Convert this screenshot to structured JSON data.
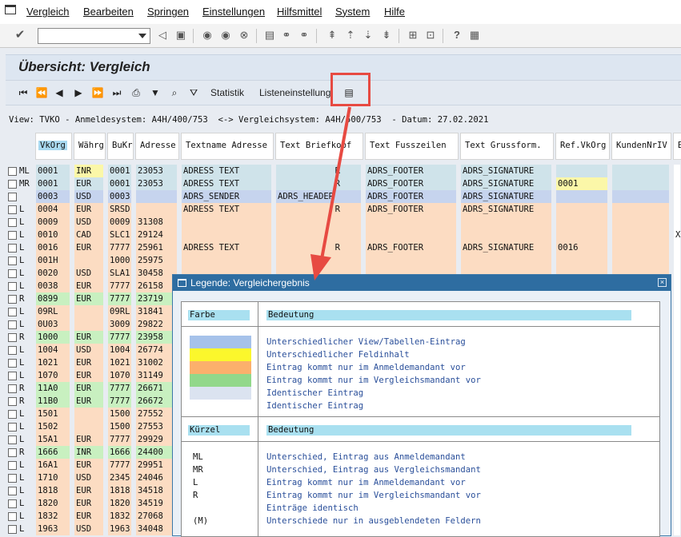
{
  "menu": [
    "Vergleich",
    "Bearbeiten",
    "Springen",
    "Einstellungen",
    "Hilfsmittel",
    "System",
    "Hilfe"
  ],
  "command_field": {
    "value": ""
  },
  "screen": {
    "title": "Übersicht: Vergleich"
  },
  "app_toolbar": {
    "statistik": "Statistik",
    "listeneinstellung": "Listeneinstellung"
  },
  "view_line": "View: TVKO - Anmeldesystem: A4H/400/753  <-> Vergleichsystem: A4H/500/753  - Datum: 27.02.2021",
  "table": {
    "headers": [
      "VkOrg",
      "Währg",
      "BuKr",
      "Adresse",
      "Textname Adresse",
      "Text Briefkopf",
      "Text Fusszeilen",
      "Text Grussform.",
      "Ref.VkOrg",
      "KundenNrIV",
      "B"
    ],
    "rows": [
      {
        "k": "ML",
        "c": [
          "0001",
          "INR",
          "0001",
          "23053",
          "ADRESS TEXT",
          "R",
          "ADRS_FOOTER",
          "ADRS_SIGNATURE",
          "",
          "",
          ""
        ]
      },
      {
        "k": "MR",
        "c": [
          "0001",
          "EUR",
          "0001",
          "23053",
          "ADRESS TEXT",
          "R",
          "ADRS_FOOTER",
          "ADRS_SIGNATURE",
          "0001",
          "",
          ""
        ]
      },
      {
        "k": "",
        "c": [
          "0003",
          "USD",
          "0003",
          "",
          "ADRS_SENDER",
          "ADRS_HEADER",
          "ADRS_FOOTER",
          "ADRS_SIGNATURE",
          "",
          "",
          ""
        ]
      },
      {
        "k": "L",
        "c": [
          "0004",
          "EUR",
          "SRSD",
          "",
          "ADRESS TEXT",
          "R",
          "ADRS_FOOTER",
          "ADRS_SIGNATURE",
          "",
          "",
          ""
        ]
      },
      {
        "k": "L",
        "c": [
          "0009",
          "USD",
          "0009",
          "31308",
          "",
          "",
          "",
          "",
          "",
          "",
          ""
        ]
      },
      {
        "k": "L",
        "c": [
          "0010",
          "CAD",
          "SLC1",
          "29124",
          "",
          "",
          "",
          "",
          "",
          "",
          "X"
        ]
      },
      {
        "k": "L",
        "c": [
          "0016",
          "EUR",
          "7777",
          "25961",
          "ADRESS TEXT",
          "R",
          "ADRS_FOOTER",
          "ADRS_SIGNATURE",
          "0016",
          "",
          ""
        ]
      },
      {
        "k": "L",
        "c": [
          "001H",
          "",
          "1000",
          "25975",
          "",
          "",
          "",
          "",
          "",
          "",
          ""
        ]
      },
      {
        "k": "L",
        "c": [
          "0020",
          "USD",
          "SLA1",
          "30458",
          "",
          "",
          "",
          "",
          "",
          "",
          ""
        ]
      },
      {
        "k": "L",
        "c": [
          "0038",
          "EUR",
          "7777",
          "26158",
          "",
          "",
          "",
          "",
          "",
          "",
          ""
        ]
      },
      {
        "k": "R",
        "c": [
          "0899",
          "EUR",
          "7777",
          "23719",
          "",
          "",
          "",
          "",
          "",
          "",
          ""
        ]
      },
      {
        "k": "L",
        "c": [
          "09RL",
          "",
          "09RL",
          "31841",
          "",
          "",
          "",
          "",
          "",
          "",
          ""
        ]
      },
      {
        "k": "L",
        "c": [
          "0U03",
          "",
          "3009",
          "29822",
          "",
          "",
          "",
          "",
          "",
          "",
          ""
        ]
      },
      {
        "k": "R",
        "c": [
          "1000",
          "EUR",
          "7777",
          "23958",
          "",
          "",
          "",
          "",
          "",
          "",
          ""
        ]
      },
      {
        "k": "L",
        "c": [
          "1004",
          "USD",
          "1004",
          "26774",
          "",
          "",
          "",
          "",
          "",
          "",
          ""
        ]
      },
      {
        "k": "L",
        "c": [
          "1021",
          "EUR",
          "1021",
          "31002",
          "",
          "",
          "",
          "",
          "",
          "",
          ""
        ]
      },
      {
        "k": "L",
        "c": [
          "1070",
          "EUR",
          "1070",
          "31149",
          "",
          "",
          "",
          "",
          "",
          "",
          ""
        ]
      },
      {
        "k": "R",
        "c": [
          "11A0",
          "EUR",
          "7777",
          "26671",
          "",
          "",
          "",
          "",
          "",
          "",
          ""
        ]
      },
      {
        "k": "R",
        "c": [
          "11B0",
          "EUR",
          "7777",
          "26672",
          "",
          "",
          "",
          "",
          "",
          "",
          ""
        ]
      },
      {
        "k": "L",
        "c": [
          "1501",
          "",
          "1500",
          "27552",
          "",
          "",
          "",
          "",
          "",
          "",
          ""
        ]
      },
      {
        "k": "L",
        "c": [
          "1502",
          "",
          "1500",
          "27553",
          "",
          "",
          "",
          "",
          "",
          "",
          ""
        ]
      },
      {
        "k": "L",
        "c": [
          "15A1",
          "EUR",
          "7777",
          "29929",
          "",
          "",
          "",
          "",
          "",
          "",
          ""
        ]
      },
      {
        "k": "R",
        "c": [
          "1666",
          "INR",
          "1666",
          "24400",
          "",
          "",
          "",
          "",
          "",
          "",
          ""
        ]
      },
      {
        "k": "L",
        "c": [
          "16A1",
          "EUR",
          "7777",
          "29951",
          "",
          "",
          "",
          "",
          "",
          "",
          ""
        ]
      },
      {
        "k": "L",
        "c": [
          "1710",
          "USD",
          "2345",
          "24046",
          "",
          "",
          "",
          "",
          "",
          "",
          ""
        ]
      },
      {
        "k": "L",
        "c": [
          "1818",
          "EUR",
          "1818",
          "34518",
          "",
          "",
          "",
          "",
          "",
          "",
          ""
        ]
      },
      {
        "k": "L",
        "c": [
          "1820",
          "EUR",
          "1820",
          "34519",
          "",
          "",
          "",
          "",
          "",
          "",
          ""
        ]
      },
      {
        "k": "L",
        "c": [
          "1832",
          "EUR",
          "1832",
          "27068",
          "",
          "",
          "",
          "",
          "",
          "",
          ""
        ]
      },
      {
        "k": "L",
        "c": [
          "1963",
          "USD",
          "1963",
          "34048",
          "",
          "",
          "",
          "",
          "",
          "",
          ""
        ]
      }
    ]
  },
  "legend": {
    "title": "Legende: Vergleichergebnis",
    "color_header": "Farbe",
    "meaning_header": "Bedeutung",
    "colors": [
      {
        "color": "#a6c2ea",
        "text": "Unterschiedlicher View/Tabellen-Eintrag"
      },
      {
        "color": "#fbf72c",
        "text": "Unterschiedlicher Feldinhalt"
      },
      {
        "color": "#fbb06c",
        "text": "Eintrag kommt nur im Anmeldemandant vor"
      },
      {
        "color": "#92d88a",
        "text": "Eintrag kommt nur im Vergleichsmandant vor"
      },
      {
        "color": "#dbe3f0",
        "text": "Identischer Eintrag"
      },
      {
        "color": "#ffffff",
        "text": "Identischer Eintrag"
      }
    ],
    "abbr_header": "Kürzel",
    "abbr_meaning_header": "Bedeutung",
    "abbreviations": [
      {
        "code": "ML",
        "text": "Unterschied, Eintrag aus Anmeldemandant"
      },
      {
        "code": "MR",
        "text": "Unterschied, Eintrag aus Vergleichsmandant"
      },
      {
        "code": "L",
        "text": "Eintrag kommt nur im Anmeldemandant vor"
      },
      {
        "code": "R",
        "text": "Eintrag kommt nur im Vergleichsmandant vor"
      },
      {
        "code": "",
        "text": "Einträge identisch"
      },
      {
        "code": "(M)",
        "text": "Unterschiede nur in ausgeblendeten Feldern"
      }
    ]
  }
}
